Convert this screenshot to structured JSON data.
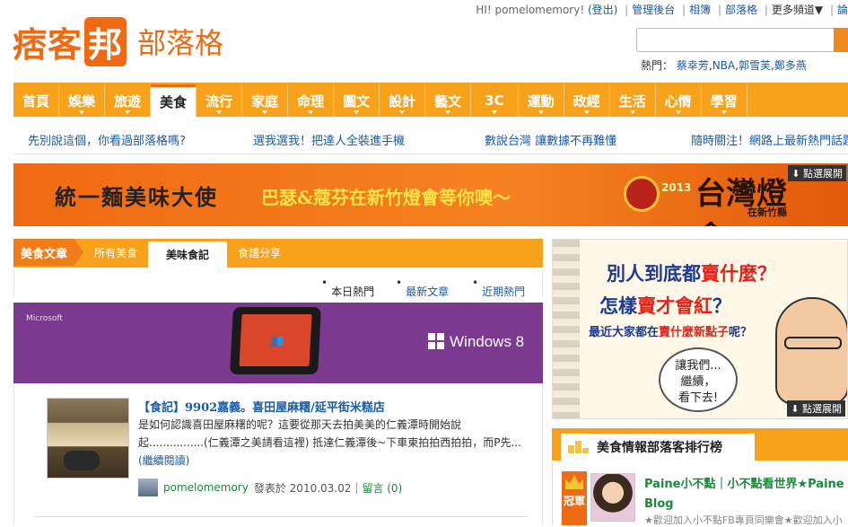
{
  "logo": {
    "mark": "痞客",
    "mark_pill": "邦",
    "sub": "部落格"
  },
  "top_links": {
    "greeting": "HI! pomelomemory!",
    "logout": "(登出)",
    "items": [
      "管理後台",
      "相簿",
      "部落格",
      "更多頻道▼",
      "論"
    ]
  },
  "search": {
    "placeholder": ""
  },
  "hot": {
    "label": "熱門：",
    "items": [
      "蔡幸芳",
      "NBA",
      "郭雪芙",
      "鄭多燕"
    ]
  },
  "nav": {
    "items": [
      "首頁",
      "娛樂",
      "旅遊",
      "美食",
      "流行",
      "家庭",
      "命理",
      "圖文",
      "設計",
      "藝文",
      "3C",
      "運動",
      "政經",
      "生活",
      "心情",
      "學習"
    ],
    "active_index": 3
  },
  "subnav": {
    "items": [
      "先別說這個，你看過部落格嗎?",
      "選我選我！把達人全裝進手機",
      "數說台灣 讓數據不再難懂",
      "隨時關注！網路上最新熱門話題"
    ]
  },
  "banner": {
    "title": "統一麵美味大使",
    "subtitle": "巴瑟&蔻芬在新竹燈會等你噢～",
    "logo_year": "2013",
    "logo_text": "台灣燈會",
    "logo_sub": "在新竹縣",
    "more": "點選展開"
  },
  "tabs": {
    "category": "美食文章",
    "items": [
      "所有美食",
      "美味食記",
      "食譜分享"
    ],
    "active_index": 1
  },
  "sorts": {
    "items": [
      "本日熱門",
      "最新文章",
      "近期熱門"
    ],
    "active_index": 0
  },
  "ad_ms": {
    "brand": "Microsoft",
    "product": "Windows 8"
  },
  "post": {
    "title": "【食記】9902嘉義。喜田屋麻糬/延平街米糕店",
    "excerpt": "是如何認識喜田屋麻糬的呢？這要從那天去拍美美的仁義潭時開始說起................(仁義潭之美請看這裡) 抵達仁義潭後~下車東拍拍西拍拍，而P先...",
    "continue": "(繼續閱讀)",
    "author": "pomelomemory",
    "published": "發表於 2010.03.02",
    "comments": "留言 (0)"
  },
  "side_ad": {
    "line1a": "別人到底都",
    "line1b": "賣什麼？",
    "line2a": "怎樣",
    "line2b": "賣才會紅",
    "line2c": "？",
    "line3a": "最近大家都在",
    "line3b": "賣什麼新點子",
    "line3c": "呢？",
    "bubble": "讓我們...\n繼續，\n看下去!",
    "more": "點選展開"
  },
  "rank": {
    "title": "美食情報部落客排行榜",
    "badge": "冠軍",
    "name": "Paine小不點｜小不點看世界★Paine Blog",
    "desc": "★歡迎加入小不點FB專頁同樂會★歡迎加入小"
  },
  "colors": {
    "accent": "#f7a21a",
    "brand": "#ef6a12",
    "link": "#1a5aa6"
  }
}
